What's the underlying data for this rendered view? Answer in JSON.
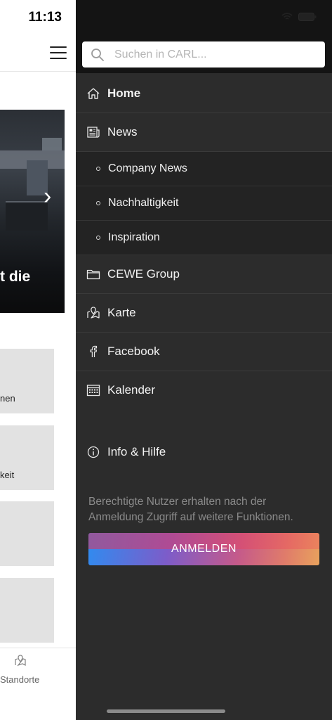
{
  "status_bar": {
    "time": "11:13"
  },
  "background_app": {
    "hero_text": "t die",
    "tiles": [
      {
        "label": "nen"
      },
      {
        "label": "keit"
      },
      {
        "label": ""
      },
      {
        "label": ""
      }
    ],
    "tab_bar": {
      "standorte_label": "Standorte"
    }
  },
  "drawer": {
    "search": {
      "placeholder": "Suchen in CARL..."
    },
    "menu": [
      {
        "label": "Home",
        "icon": "home-icon",
        "active": true
      },
      {
        "label": "News",
        "icon": "newspaper-icon",
        "expanded": true,
        "children": [
          {
            "label": "Company News"
          },
          {
            "label": "Nachhaltigkeit"
          },
          {
            "label": "Inspiration"
          }
        ]
      },
      {
        "label": "CEWE Group",
        "icon": "folder-icon"
      },
      {
        "label": "Karte",
        "icon": "map-pin-icon"
      },
      {
        "label": "Facebook",
        "icon": "facebook-icon"
      },
      {
        "label": "Kalender",
        "icon": "calendar-icon"
      }
    ],
    "info_help": {
      "label": "Info & Hilfe",
      "icon": "info-icon"
    },
    "hint_text": "Berechtigte Nutzer erhalten nach der Anmeldung Zugriff auf weitere Funktionen.",
    "login_button": {
      "label": "ANMELDEN"
    }
  },
  "colors": {
    "drawer_bg": "#2c2c2c",
    "drawer_top_bg": "#141414",
    "submenu_bg": "#232323",
    "text": "#f2f2f2",
    "hint_text": "#8a8a8a",
    "button_gradient": [
      "#2f8cf0",
      "#7d5cc9",
      "#e2305a",
      "#e8a25d"
    ]
  }
}
